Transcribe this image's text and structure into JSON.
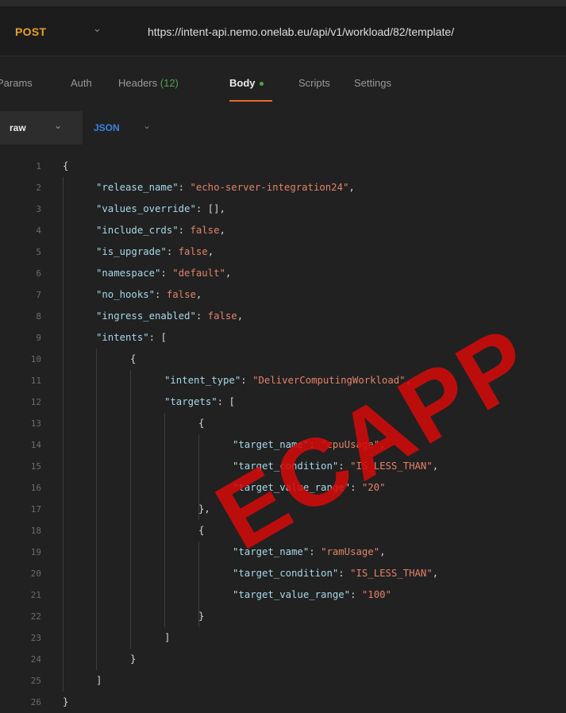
{
  "request": {
    "method": "POST",
    "url": "https://intent-api.nemo.onelab.eu/api/v1/workload/82/template/"
  },
  "tabs": [
    {
      "label": "Params"
    },
    {
      "label": "Auth"
    },
    {
      "label": "Headers",
      "count": "(12)"
    },
    {
      "label": "Body",
      "active": true
    },
    {
      "label": "Scripts"
    },
    {
      "label": "Settings"
    }
  ],
  "body_options": {
    "mode": "raw",
    "language": "JSON"
  },
  "editor": {
    "line_numbers": [
      "1",
      "2",
      "3",
      "4",
      "5",
      "6",
      "7",
      "8",
      "9",
      "10",
      "11",
      "12",
      "13",
      "14",
      "15",
      "16",
      "17",
      "18",
      "19",
      "20",
      "21",
      "22",
      "23",
      "24",
      "25",
      "26"
    ],
    "keys": {
      "release_name": "\"release_name\"",
      "values_override": "\"values_override\"",
      "include_crds": "\"include_crds\"",
      "is_upgrade": "\"is_upgrade\"",
      "namespace": "\"namespace\"",
      "no_hooks": "\"no_hooks\"",
      "ingress_enabled": "\"ingress_enabled\"",
      "intents": "\"intents\"",
      "intent_type": "\"intent_type\"",
      "targets": "\"targets\"",
      "target_name": "\"target_name\"",
      "target_condition": "\"target_condition\"",
      "target_value_range": "\"target_value_range\""
    },
    "values": {
      "release_name": "\"echo-server-integration24\"",
      "values_override": "[]",
      "include_crds": "false",
      "is_upgrade": "false",
      "namespace": "\"default\"",
      "no_hooks": "false",
      "ingress_enabled": "false",
      "intent_type": "\"DeliverComputingWorkload\"",
      "target1_name": "\"cpuUsage\"",
      "target1_condition": "\"IS_LESS_THAN\"",
      "target1_value_range": "\"20\"",
      "target2_name": "\"ramUsage\"",
      "target2_condition": "\"IS_LESS_THAN\"",
      "target2_value_range": "\"100\""
    }
  },
  "watermark": {
    "text": "ECAPP",
    "color": "#d20a0a"
  }
}
